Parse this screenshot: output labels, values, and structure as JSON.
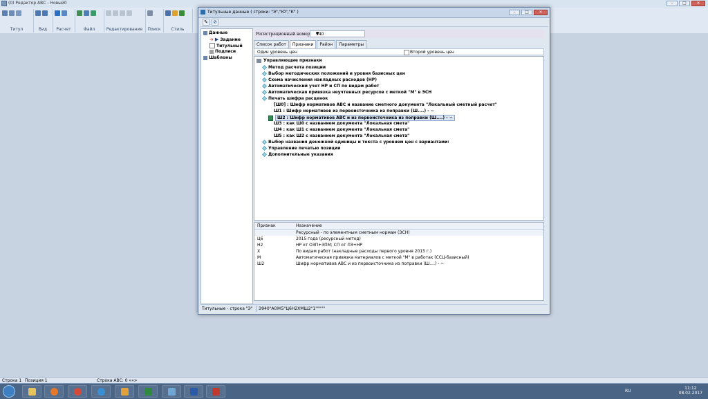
{
  "app": {
    "title": "(0) Редактор АВС - Новый0"
  },
  "ribbon": {
    "groups": [
      "Титул",
      "Вид",
      "Расчет",
      "Файл",
      "Редактирование",
      "Поиск",
      "Стиль"
    ]
  },
  "statusbar": {
    "row": "Строка  1",
    "position": "Позиция  1",
    "abc_row": "Строка АВС:  0  «»>"
  },
  "taskbar": {
    "lang": "RU",
    "time": "11:12",
    "date": "08.02.2017"
  },
  "dialog": {
    "title": "Титульные данные ( строки: \"Э\",\"Ю\",\"К\" )",
    "nav": [
      {
        "label": "Данные"
      },
      {
        "label": "Задание"
      },
      {
        "label": "Титульный"
      },
      {
        "label": "Подписи"
      },
      {
        "label": "Шаблоны"
      }
    ],
    "reg_label": "Регистрационный номер",
    "reg_value": "940",
    "tabs": [
      "Список работ",
      "Признаки",
      "Район",
      "Параметры"
    ],
    "level1": "Один уровень цен",
    "level2": "Второй уровень цен",
    "tree": {
      "root": "Управляющие признаки",
      "items": [
        "Метод расчета позиции",
        "Выбор методических положений и уровня базисных цен",
        "Схема начисления накладных расходов (НР)",
        "Автоматический учет НР и СП по видам работ",
        "Автоматическая привязка неучтенных ресурсов с меткой \"М\" в ЭСН",
        "Печать шифра расценок"
      ],
      "sub": [
        "[Ш0] : Шифр нормативов АВС и название сметного документа \"Локальный сметный расчет\"",
        "Ш1 : Шифр нормативов из первоисточника из поправки (Ш....) - ~",
        "Ш2 : Шифр нормативов АВС и из первоисточника из поправки (Ш....) - ~",
        "Ш3 : как Ш0 с названием документа \"Локальная смета\"",
        "Ш4 : как Ш1 с названием документа \"Локальная смета\"",
        "Ш5 : как Ш2 с названием документа \"Локальная смета\""
      ],
      "after": [
        "Выбор названия денежной единицы и текста с уровнем цен с вариантами:",
        "Управление печатью позиции",
        "Дополнительные указания"
      ]
    },
    "detail": {
      "headers": [
        "Признак",
        "Назначение"
      ],
      "rows": [
        {
          "code": "",
          "desc": "Ресурсный - по элементным сметным нормам (ЭСН)"
        },
        {
          "code": "Ц6",
          "desc": "2015 года (ресурсный метод)"
        },
        {
          "code": "Н2",
          "desc": "НР от ОЗП+ЗПМ; СП от ПЗ+НР"
        },
        {
          "code": "Х",
          "desc": "По видам работ (накладные расходы первого уровня 2015 г.)"
        },
        {
          "code": "М",
          "desc": "Автоматическая привязка материалов с меткой \"М\" в работах (ССЦ-базисный)"
        },
        {
          "code": "Ш2",
          "desc": "Шифр нормативов АВС и из первоисточника из поправки (Ш....) - ~"
        }
      ]
    },
    "status_left": "Титульные - строка \"Э\"",
    "status_right": "Э940\"А0Ж5\"Ц6Н2ХМШ2\"1\"\"\"\"\""
  }
}
